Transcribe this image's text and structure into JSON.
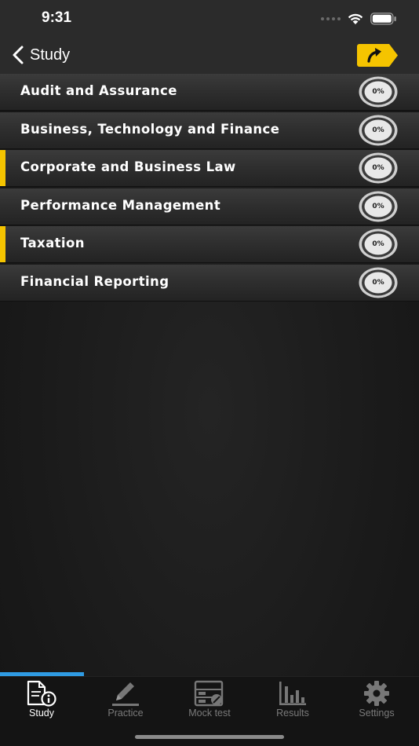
{
  "status_bar": {
    "time": "9:31"
  },
  "nav": {
    "back_label": "Study",
    "accent_color": "#f5c400"
  },
  "subjects": [
    {
      "label": "Audit and Assurance",
      "progress": "0%",
      "highlighted": false
    },
    {
      "label": "Business, Technology and Finance",
      "progress": "0%",
      "highlighted": false
    },
    {
      "label": "Corporate and Business Law",
      "progress": "0%",
      "highlighted": true
    },
    {
      "label": "Performance Management",
      "progress": "0%",
      "highlighted": false
    },
    {
      "label": "Taxation",
      "progress": "0%",
      "highlighted": true
    },
    {
      "label": "Financial Reporting",
      "progress": "0%",
      "highlighted": false
    }
  ],
  "tabs": [
    {
      "label": "Study",
      "icon": "document-info-icon",
      "active": true
    },
    {
      "label": "Practice",
      "icon": "pencil-icon",
      "active": false
    },
    {
      "label": "Mock test",
      "icon": "exam-sheet-icon",
      "active": false
    },
    {
      "label": "Results",
      "icon": "bar-chart-icon",
      "active": false
    },
    {
      "label": "Settings",
      "icon": "gear-icon",
      "active": false
    }
  ],
  "colors": {
    "tab_progress": "#2f9be3",
    "marker": "#f5c400"
  }
}
